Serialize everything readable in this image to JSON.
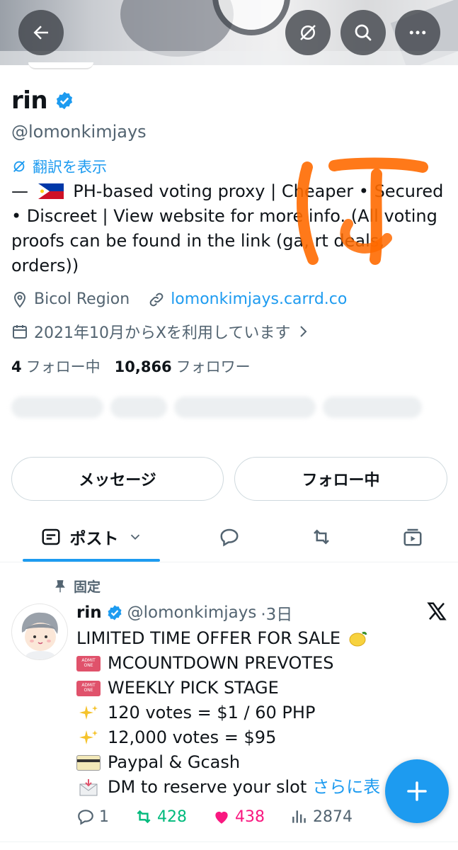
{
  "profile": {
    "name": "rin",
    "handle": "@lomonkimjays",
    "translate_label": "翻訳を表示",
    "bio_prefix": "—",
    "bio_text": "PH-based voting proxy | Cheaper • Secured • Discreet | View website for more info. (All voting proofs can be found in the link (ga, rt deals, orders))",
    "location": "Bicol Region",
    "website": "lomonkimjays.carrd.co",
    "joined": "2021年10月からXを利用しています",
    "following_count": "4",
    "following_label": "フォロー中",
    "followers_count": "10,866",
    "followers_label": "フォロワー"
  },
  "buttons": {
    "message": "メッセージ",
    "following": "フォロー中"
  },
  "tabs": {
    "posts_label": "ポスト"
  },
  "post": {
    "pinned_label": "固定",
    "author_name": "rin",
    "author_handle": "@lomonkimjays",
    "time": "·3日",
    "lines": [
      {
        "icon": "lemon",
        "text": "LIMITED TIME OFFER FOR SALE"
      },
      {
        "icon": "ticket",
        "text": "MCOUNTDOWN PREVOTES"
      },
      {
        "icon": "ticket",
        "text": "WEEKLY PICK STAGE"
      },
      {
        "icon": "sparkles",
        "text": "120 votes = $1 / 60 PHP"
      },
      {
        "icon": "sparkles",
        "text": "12,000 votes = $95"
      },
      {
        "icon": "credit-card",
        "text": "Paypal & Gcash"
      },
      {
        "icon": "envelope",
        "text": "DM to reserve your slot"
      }
    ],
    "more_label": "さらに表",
    "replies": "1",
    "reposts": "428",
    "likes": "438",
    "views": "2874"
  },
  "colors": {
    "accent": "#1d9bf0",
    "repost_green": "#00ba7c",
    "like_pink": "#f91880",
    "muted": "#536471",
    "scribble_orange": "#ff6a00"
  }
}
